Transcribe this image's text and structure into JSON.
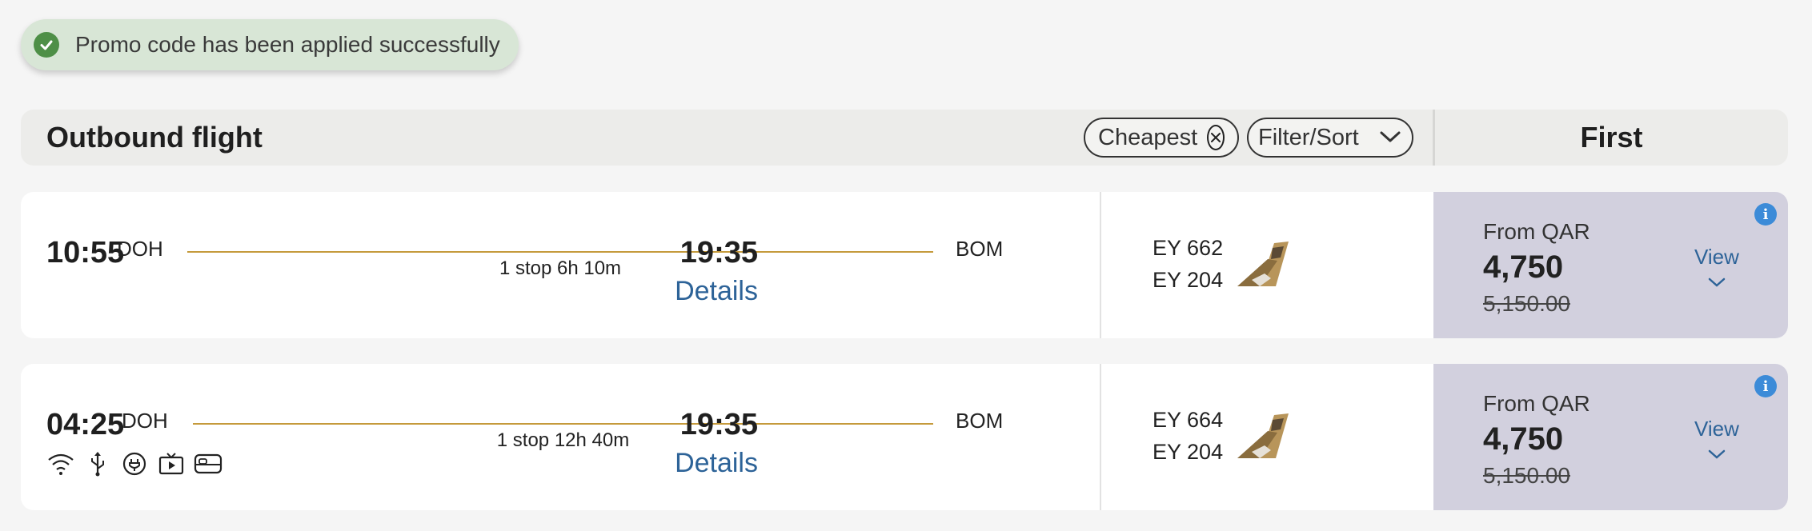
{
  "toast": {
    "message": "Promo code has been applied successfully",
    "icon": "check-circle-icon",
    "color": "#4e8f47"
  },
  "header": {
    "title": "Outbound flight",
    "chip_cheapest": "Cheapest",
    "chip_filter": "Filter/Sort",
    "cabin": "First"
  },
  "flights": [
    {
      "dep_time": "10:55",
      "dep_code": "DOH",
      "stops": "1 stop 6h 10m",
      "arr_code": "BOM",
      "arr_time": "19:35",
      "details": "Details",
      "flight_no_1": "EY 662",
      "flight_no_2": "EY 204",
      "fare_from": "From QAR",
      "fare_price": "4,750",
      "fare_old": "5,150.00",
      "view": "View",
      "amenities": []
    },
    {
      "dep_time": "04:25",
      "dep_code": "DOH",
      "stops": "1 stop 12h 40m",
      "arr_code": "BOM",
      "arr_time": "19:35",
      "details": "Details",
      "flight_no_1": "EY 664",
      "flight_no_2": "EY 204",
      "fare_from": "From QAR",
      "fare_price": "4,750",
      "fare_old": "5,150.00",
      "view": "View",
      "amenities": [
        "wifi-icon",
        "usb-icon",
        "power-outlet-icon",
        "entertainment-icon",
        "flat-bed-icon"
      ]
    }
  ],
  "colors": {
    "accent_link": "#2d6398",
    "route_line": "#c59a3c",
    "fare_bg": "#d2d0de",
    "info": "#3c8bd8"
  }
}
